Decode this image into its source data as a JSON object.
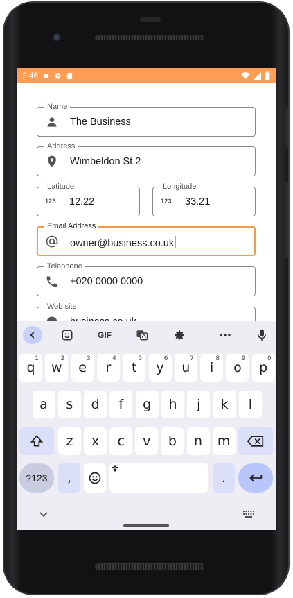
{
  "status_bar": {
    "time": "2:46"
  },
  "form": {
    "name": {
      "label": "Name",
      "value": "The Business"
    },
    "address": {
      "label": "Address",
      "value": "Wimbeldon St.2"
    },
    "latitude": {
      "label": "Latitude",
      "value": "12.22",
      "icon_text": "123"
    },
    "longitude": {
      "label": "Longitude",
      "value": "33.21",
      "icon_text": "123"
    },
    "email": {
      "label": "Email Address",
      "value": "owner@business.co.uk"
    },
    "telephone": {
      "label": "Telephone",
      "value": "+020 0000 0000"
    },
    "website": {
      "label": "Web site",
      "value": "business.co.uk"
    }
  },
  "keyboard": {
    "toolbar": {
      "gif_label": "GIF"
    },
    "row1": [
      {
        "key": "q",
        "hint": "1"
      },
      {
        "key": "w",
        "hint": "2"
      },
      {
        "key": "e",
        "hint": "3"
      },
      {
        "key": "r",
        "hint": "4"
      },
      {
        "key": "t",
        "hint": "5"
      },
      {
        "key": "y",
        "hint": "6"
      },
      {
        "key": "u",
        "hint": "7"
      },
      {
        "key": "i",
        "hint": "8"
      },
      {
        "key": "o",
        "hint": "9"
      },
      {
        "key": "p",
        "hint": "0"
      }
    ],
    "row2": [
      "a",
      "s",
      "d",
      "f",
      "g",
      "h",
      "j",
      "k",
      "l"
    ],
    "row3": [
      "z",
      "x",
      "c",
      "v",
      "b",
      "n",
      "m"
    ],
    "symbols_label": "?123",
    "comma": ",",
    "period": "."
  },
  "colors": {
    "status_bar": "#ff9d55",
    "focus": "#f39a4a",
    "keyboard_bg": "#eeedf4",
    "enter_key": "#b9c6fb"
  }
}
